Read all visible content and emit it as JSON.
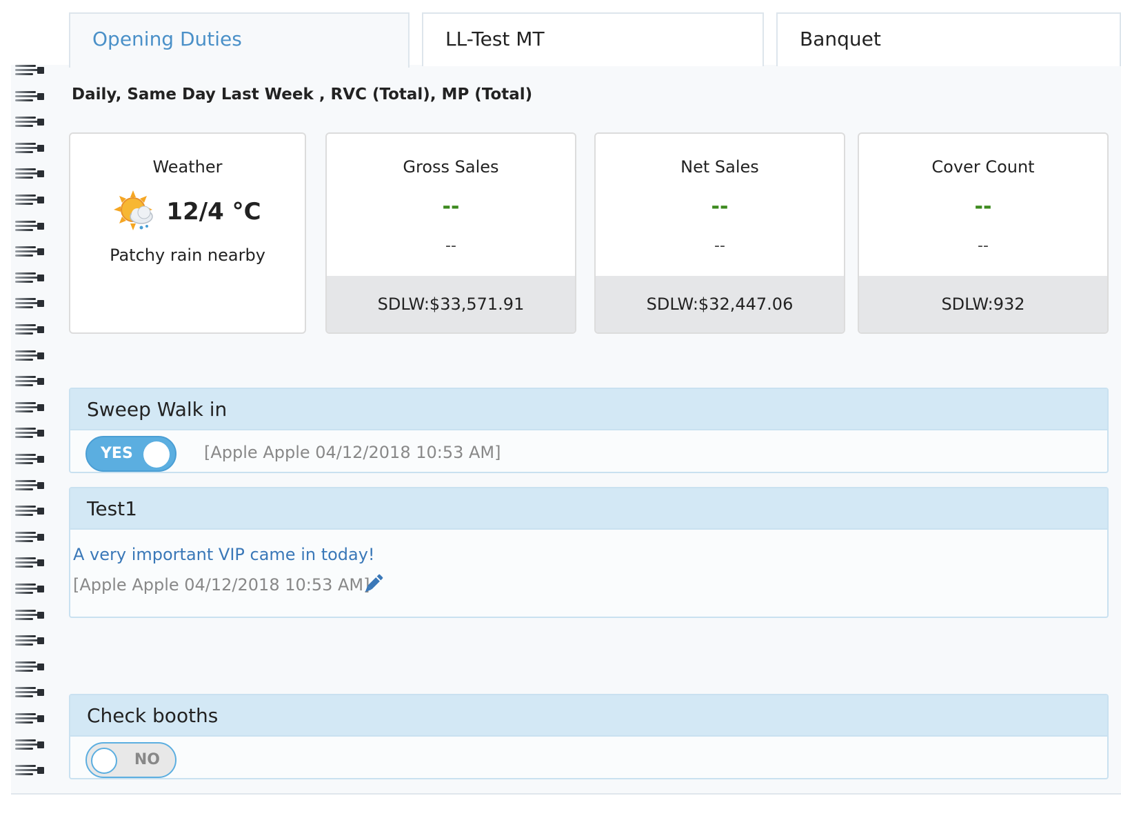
{
  "tabs": [
    {
      "label": "Opening Duties",
      "active": true
    },
    {
      "label": "LL-Test MT",
      "active": false
    },
    {
      "label": "Banquet",
      "active": false
    }
  ],
  "filters_text": "Daily, Same Day Last Week , RVC (Total), MP (Total)",
  "weather": {
    "title": "Weather",
    "temperature": "12/4 °C",
    "description": "Patchy rain nearby",
    "icon": "sun-cloud-rain-icon"
  },
  "stats": {
    "gross_sales": {
      "title": "Gross Sales",
      "value": "--",
      "sub": "--",
      "footer": "SDLW:$33,571.91"
    },
    "net_sales": {
      "title": "Net Sales",
      "value": "--",
      "sub": "--",
      "footer": "SDLW:$32,447.06"
    },
    "cover_count": {
      "title": "Cover Count",
      "value": "--",
      "sub": "--",
      "footer": "SDLW:932"
    }
  },
  "tasks": [
    {
      "title": "Sweep Walk in",
      "toggle_label": "YES",
      "toggle_on": true,
      "stamp": "[Apple Apple 04/12/2018 10:53 AM]"
    },
    {
      "title": "Test1",
      "note": "A very important VIP came in today!",
      "stamp": "[Apple Apple 04/12/2018 10:53 AM]"
    },
    {
      "title": "Check booths",
      "toggle_label": "NO",
      "toggle_on": false
    }
  ],
  "colors": {
    "accent": "#4a90c8",
    "value_green": "#3d8a1f",
    "panel_header": "#d3e8f5",
    "toggle_on": "#5baee0"
  }
}
